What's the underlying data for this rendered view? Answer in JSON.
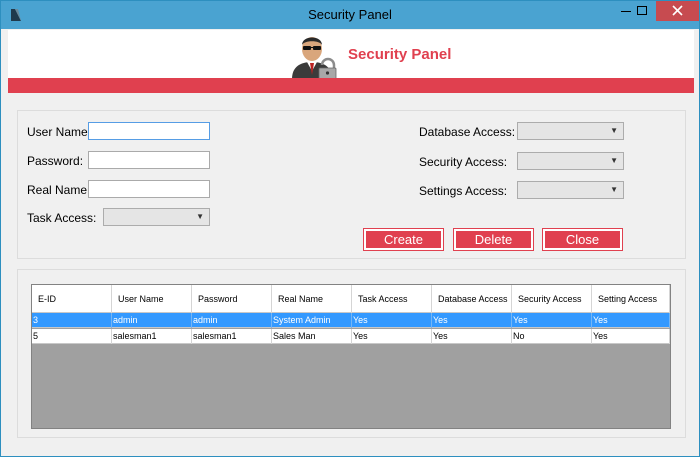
{
  "window": {
    "title": "Security Panel"
  },
  "header": {
    "title": "Security Panel"
  },
  "form": {
    "user_name_label": "User Name:",
    "password_label": "Password:",
    "real_name_label": "Real Name:",
    "task_access_label": "Task Access:",
    "database_access_label": "Database Access:",
    "security_access_label": "Security Access:",
    "settings_access_label": "Settings Access:",
    "user_name_value": "",
    "password_value": "",
    "real_name_value": ""
  },
  "buttons": {
    "create": "Create",
    "delete": "Delete",
    "close": "Close"
  },
  "grid": {
    "columns": [
      "E-ID",
      "User Name",
      "Password",
      "Real Name",
      "Task Access",
      "Database Access",
      "Security Access",
      "Setting Access"
    ],
    "rows": [
      [
        "3",
        "admin",
        "admin",
        "System Admin",
        "Yes",
        "Yes",
        "Yes",
        "Yes"
      ],
      [
        "5",
        "salesman1",
        "salesman1",
        "Sales Man",
        "Yes",
        "Yes",
        "No",
        "Yes"
      ]
    ],
    "selected_row": 0
  },
  "colors": {
    "accent": "#e0404f",
    "titlebar": "#4aa3d1",
    "selection": "#3399ff"
  }
}
